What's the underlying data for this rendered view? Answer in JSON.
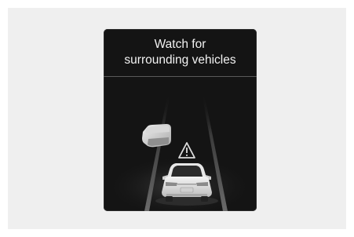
{
  "notification": {
    "line1": "Watch for",
    "line2": "surrounding vehicles"
  },
  "icons": {
    "warning": "warning-triangle-icon",
    "ego_vehicle": "car-rear-icon",
    "surrounding_vehicle": "vehicle-icon"
  },
  "colors": {
    "panel": "#141414",
    "frame_background": "#efefef",
    "text": "#f2f2f2"
  }
}
